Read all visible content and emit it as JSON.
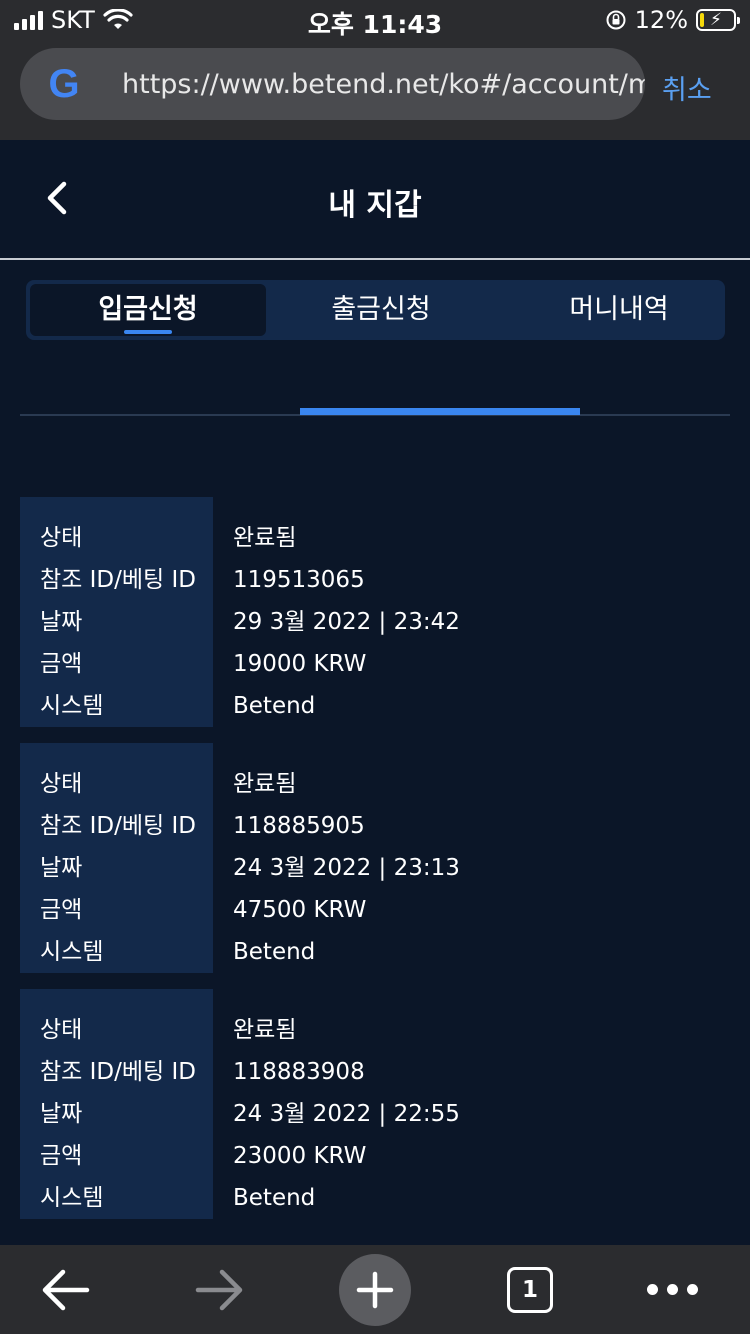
{
  "status_bar": {
    "carrier": "SKT",
    "time": "오후 11:43",
    "battery_percent": "12%",
    "battery_level": 0.12
  },
  "browser": {
    "url": "https://www.betend.net/ko#/account/my",
    "cancel_label": "취소",
    "google_logo_letter": "G",
    "open_tab_count": "1"
  },
  "header": {
    "title": "내 지갑"
  },
  "tabs": [
    {
      "label": "입금신청",
      "active": true
    },
    {
      "label": "출금신청",
      "active": false
    },
    {
      "label": "머니내역",
      "active": false
    }
  ],
  "records": [
    {
      "labels": {
        "status": "상태",
        "ref": "참조 ID/베팅 ID",
        "date": "날짜",
        "amount": "금액",
        "system": "시스템"
      },
      "values": {
        "status": "완료됨",
        "ref": "119513065",
        "date": "29 3월 2022 | 23:42",
        "amount": "19000 KRW",
        "system": "Betend"
      }
    },
    {
      "labels": {
        "status": "상태",
        "ref": "참조 ID/베팅 ID",
        "date": "날짜",
        "amount": "금액",
        "system": "시스템"
      },
      "values": {
        "status": "완료됨",
        "ref": "118885905",
        "date": "24 3월 2022 | 23:13",
        "amount": "47500 KRW",
        "system": "Betend"
      }
    },
    {
      "labels": {
        "status": "상태",
        "ref": "참조 ID/베팅 ID",
        "date": "날짜",
        "amount": "금액",
        "system": "시스템"
      },
      "values": {
        "status": "완료됨",
        "ref": "118883908",
        "date": "24 3월 2022 | 22:55",
        "amount": "23000 KRW",
        "system": "Betend"
      }
    }
  ],
  "colors": {
    "background": "#0b1628",
    "panel": "#13294a",
    "accent": "#3a86f0",
    "browser_chrome": "#2b2c2f"
  },
  "icons": {
    "status": [
      "signal-icon",
      "wifi-icon",
      "orientation-lock-icon",
      "battery-icon"
    ],
    "header": [
      "chevron-left-icon"
    ],
    "toolbar": [
      "back-arrow-icon",
      "forward-arrow-icon",
      "plus-icon",
      "tab-switcher-icon",
      "more-dots-icon"
    ]
  }
}
